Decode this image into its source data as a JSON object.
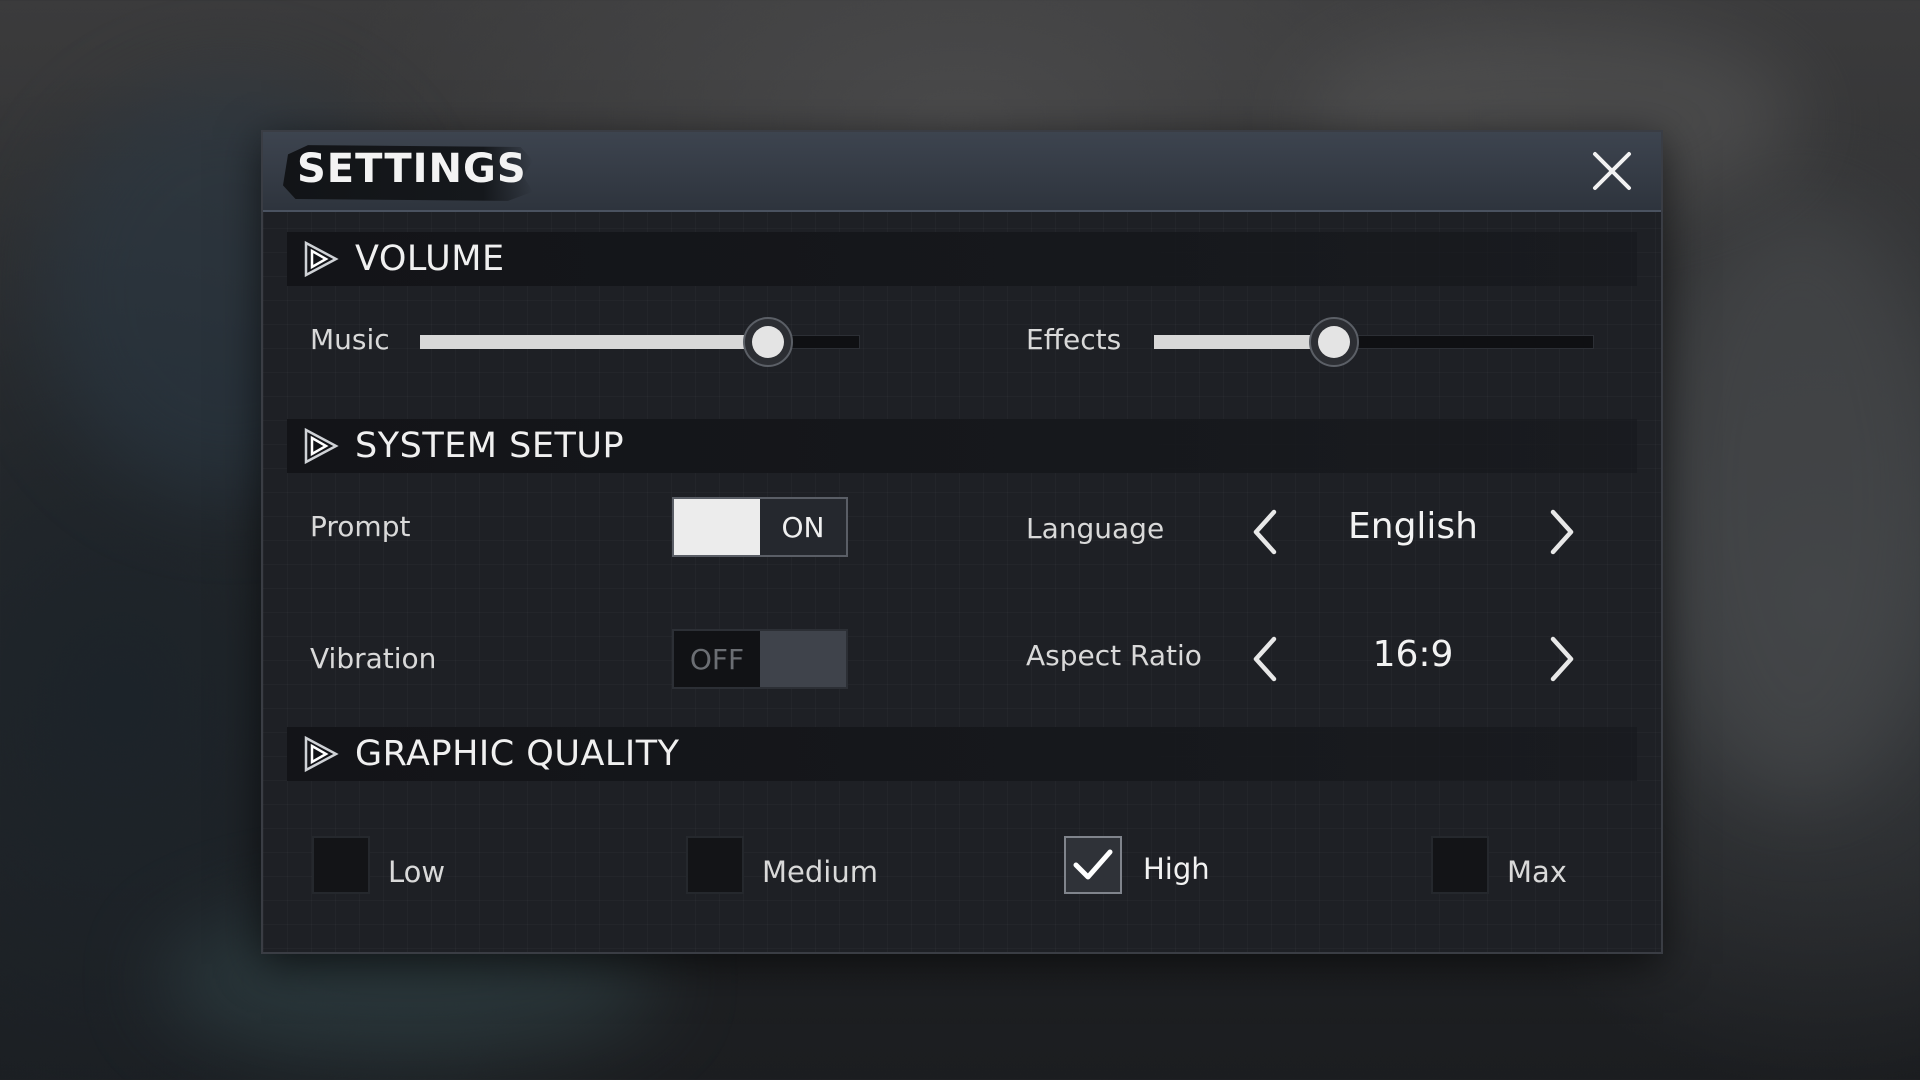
{
  "dialog": {
    "title": "SETTINGS",
    "close_icon": "close-icon"
  },
  "volume": {
    "header": "VOLUME",
    "music_label": "Music",
    "music_level": 0.79,
    "effects_label": "Effects",
    "effects_level": 0.41
  },
  "system": {
    "header": "SYSTEM SETUP",
    "prompt_label": "Prompt",
    "prompt_state": "ON",
    "vibration_label": "Vibration",
    "vibration_state": "OFF",
    "language_label": "Language",
    "language_value": "English",
    "aspect_label": "Aspect Ratio",
    "aspect_value": "16:9"
  },
  "graphics": {
    "header": "GRAPHIC QUALITY",
    "options": [
      {
        "label": "Low",
        "checked": false
      },
      {
        "label": "Medium",
        "checked": false
      },
      {
        "label": "High",
        "checked": true
      },
      {
        "label": "Max",
        "checked": false
      }
    ]
  },
  "colors": {
    "panel_bg": "#1e2025",
    "title_bar": "#3d444f",
    "accent_light": "#e4e4e4"
  }
}
